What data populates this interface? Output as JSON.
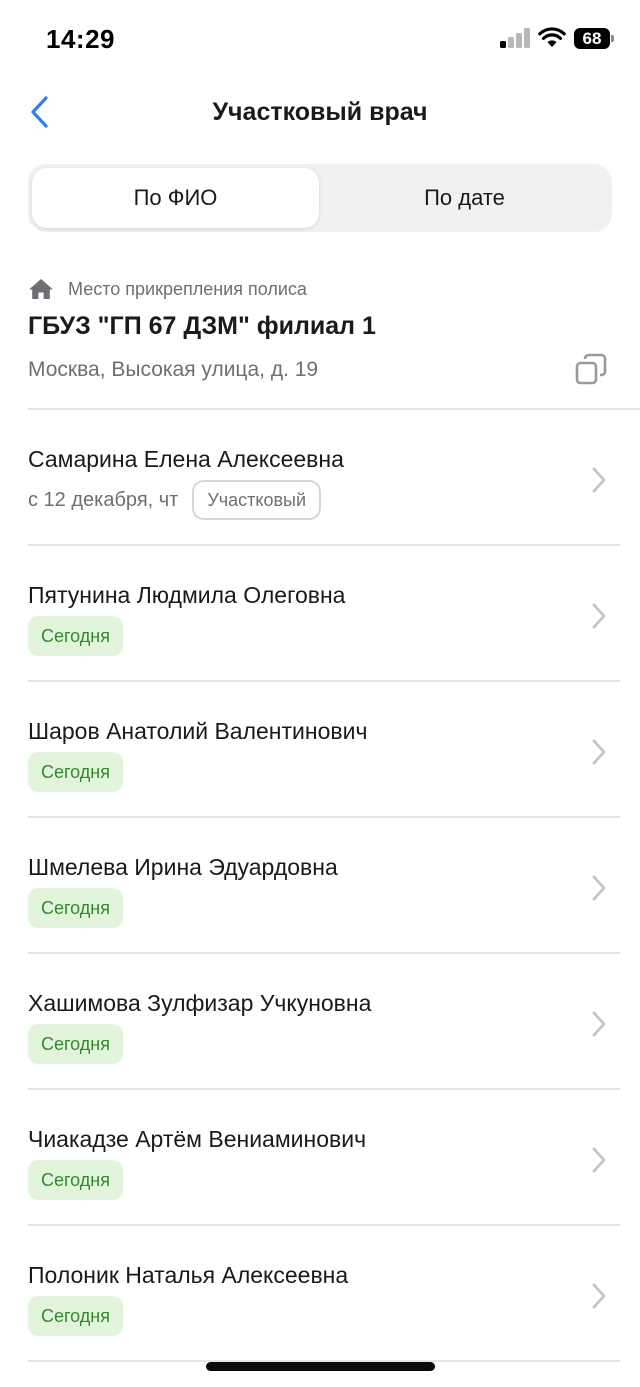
{
  "status_bar": {
    "time": "14:29",
    "battery": "68"
  },
  "header": {
    "title": "Участковый врач"
  },
  "tabs": [
    {
      "label": "По ФИО",
      "selected": true
    },
    {
      "label": "По дате",
      "selected": false
    }
  ],
  "policy": {
    "label": "Место прикрепления полиса",
    "clinic": "ГБУЗ \"ГП 67 ДЗМ\" филиал 1",
    "address": "Москва, Высокая улица, д. 19"
  },
  "doctors": [
    {
      "name": "Самарина Елена Алексеевна",
      "date": "с 12 декабря, чт",
      "badge": "Участковый"
    },
    {
      "name": "Пятунина Людмила Олеговна",
      "status": "Сегодня"
    },
    {
      "name": "Шаров Анатолий Валентинович",
      "status": "Сегодня"
    },
    {
      "name": "Шмелева Ирина Эдуардовна",
      "status": "Сегодня"
    },
    {
      "name": "Хашимова Зулфизар Учкуновна",
      "status": "Сегодня"
    },
    {
      "name": "Чиакадзе Артём Вениаминович",
      "status": "Сегодня"
    },
    {
      "name": "Полоник Наталья Алексеевна",
      "status": "Сегодня"
    }
  ],
  "colors": {
    "accent": "#2f80ed",
    "badge_today_bg": "#e2f5dc",
    "badge_today_text": "#2e8a2b",
    "secondary_text": "#6f6f73"
  }
}
